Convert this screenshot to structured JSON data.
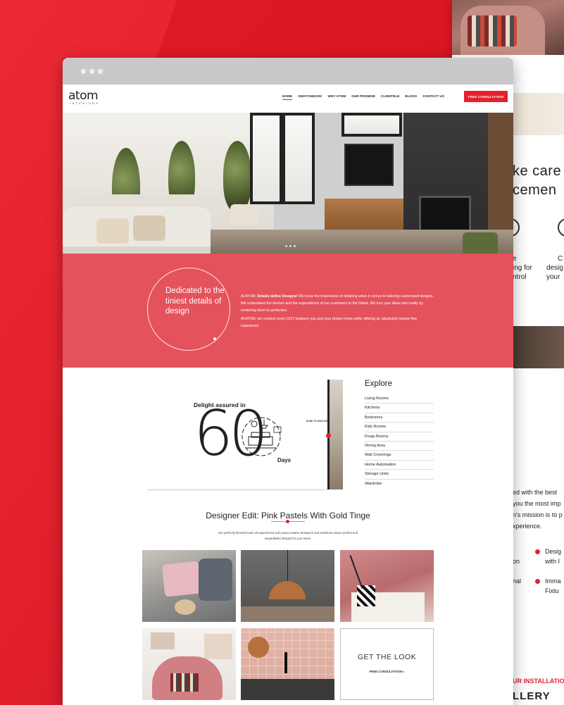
{
  "brand": {
    "logo": "atom",
    "logo_sub": "INTERIORS"
  },
  "nav": {
    "items": [
      "HOME",
      "SWATCHBOOK",
      "WHY ATOM",
      "OUR PROMISE",
      "CLIENTELE",
      "BLOGS",
      "CONTACT US"
    ],
    "active": "HOME",
    "cta": "FREE CONSULTATION"
  },
  "intro": {
    "circle_text": "Dedicated to the tiniest details of design",
    "para1_prefix": "At ATOM, ",
    "para1_bold": "Details define Designs!",
    "para1_rest": " We know the importance of detailing when it comes to tailoring customised designs. We understand the desires and the expectations of our customers to the fullest. We turn your ideas into reality by rendering them to perfection.",
    "para2": "At ATOM, we connect every DOT between you and your dream home while offering an absolutely hassle-free experience."
  },
  "promise": {
    "headline": "Delight assured in",
    "number": "60",
    "unit": "Days",
    "guide": "SLIDE TO DISCOVER"
  },
  "explore": {
    "title": "Explore",
    "items": [
      "Living Rooms",
      "Kitchens",
      "Bedrooms",
      "Kids Rooms",
      "Pooja Rooms",
      "Dining Area",
      "Wall Coverings",
      "Home Automation",
      "Storage Units",
      "Wardrobe"
    ]
  },
  "designer_edit": {
    "title": "Designer Edit: Pink Pastels With Gold Tinge",
    "subtitle": "Our perfectly blended team of experienced and young creative designers and architects assure perfect and unparalleled designs for your home.",
    "look_title": "GET THE LOOK",
    "look_cta": "FREE CONSULTATION"
  },
  "background_page": {
    "line1": "ke care",
    "line2": "cemen",
    "feat1a": "e",
    "feat1b": "ing for",
    "feat1c": "ntrol",
    "feat2a": "C",
    "feat2b": "desig",
    "feat2c": "your",
    "p1": "ed with the best",
    "p2": "you the most imp",
    "p3": "n's mission is to p",
    "p4": "xperience.",
    "b1a": "Desig",
    "b1b": "with I",
    "b2a": "Imma",
    "b2b": "Fixtu",
    "b1l": "on",
    "b2l": "nal",
    "install": "UR INSTALLATIO",
    "gallery": "LLERY"
  },
  "colors": {
    "brand_red": "#e5202f",
    "section_red": "#e4525b"
  }
}
